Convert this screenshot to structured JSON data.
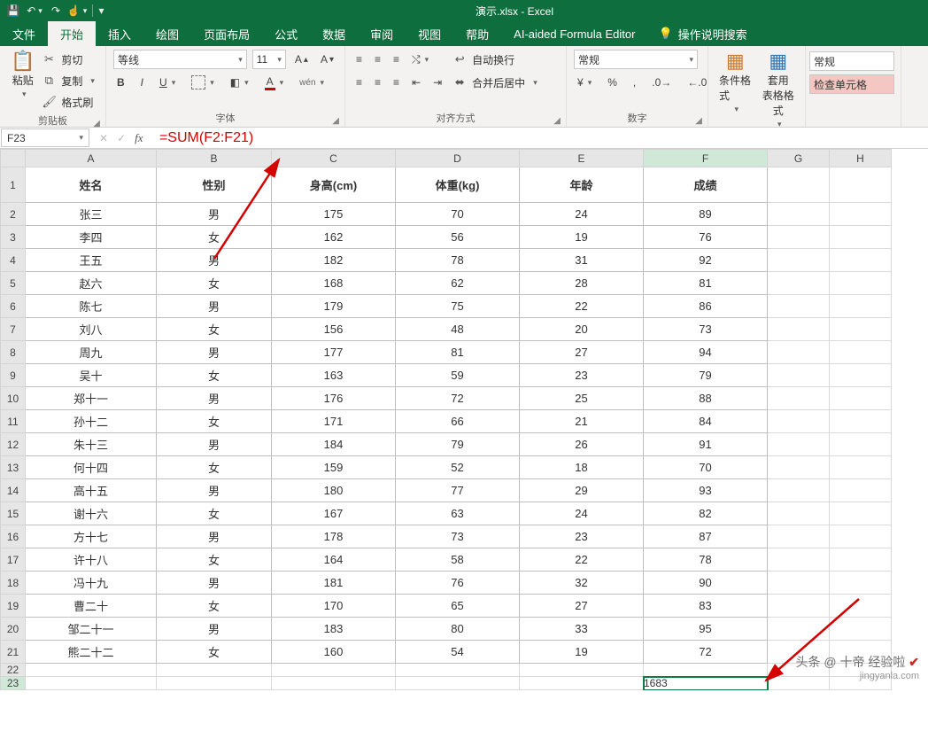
{
  "app": {
    "title": "演示.xlsx  -  Excel"
  },
  "qat": {
    "save": "save-icon",
    "undo": "undo-icon",
    "redo": "redo-icon",
    "touch": "touch-icon"
  },
  "menu": {
    "file": "文件",
    "home": "开始",
    "insert": "插入",
    "draw": "绘图",
    "layout": "页面布局",
    "formulas": "公式",
    "data": "数据",
    "review": "审阅",
    "view": "视图",
    "help": "帮助",
    "ai": "AI-aided Formula Editor",
    "tell_me": "操作说明搜索"
  },
  "ribbon": {
    "clipboard": {
      "paste": "粘贴",
      "cut": "剪切",
      "copy": "复制",
      "format_painter": "格式刷",
      "label": "剪贴板"
    },
    "font": {
      "name": "等线",
      "size": "11",
      "label": "字体",
      "wen": "wén"
    },
    "align": {
      "wrap": "自动换行",
      "merge": "合并后居中",
      "label": "对齐方式"
    },
    "number": {
      "format": "常规",
      "label": "数字"
    },
    "styles": {
      "cond": "条件格式",
      "table": "套用\n表格格式",
      "label": ""
    },
    "cells2": {
      "normal": "常规",
      "check": "检查单元格"
    }
  },
  "formula_bar": {
    "name_box": "F23",
    "formula": " =SUM(F2:F21)"
  },
  "columns": [
    "A",
    "B",
    "C",
    "D",
    "E",
    "F",
    "G",
    "H"
  ],
  "headers": {
    "c1": "姓名",
    "c2": "性别",
    "c3": "身高(cm)",
    "c4": "体重(kg)",
    "c5": "年龄",
    "c6": "成绩"
  },
  "rows": [
    {
      "n": "张三",
      "g": "男",
      "h": "175",
      "w": "70",
      "a": "24",
      "s": "89"
    },
    {
      "n": "李四",
      "g": "女",
      "h": "162",
      "w": "56",
      "a": "19",
      "s": "76"
    },
    {
      "n": "王五",
      "g": "男",
      "h": "182",
      "w": "78",
      "a": "31",
      "s": "92"
    },
    {
      "n": "赵六",
      "g": "女",
      "h": "168",
      "w": "62",
      "a": "28",
      "s": "81"
    },
    {
      "n": "陈七",
      "g": "男",
      "h": "179",
      "w": "75",
      "a": "22",
      "s": "86"
    },
    {
      "n": "刘八",
      "g": "女",
      "h": "156",
      "w": "48",
      "a": "20",
      "s": "73"
    },
    {
      "n": "周九",
      "g": "男",
      "h": "177",
      "w": "81",
      "a": "27",
      "s": "94"
    },
    {
      "n": "吴十",
      "g": "女",
      "h": "163",
      "w": "59",
      "a": "23",
      "s": "79"
    },
    {
      "n": "郑十一",
      "g": "男",
      "h": "176",
      "w": "72",
      "a": "25",
      "s": "88"
    },
    {
      "n": "孙十二",
      "g": "女",
      "h": "171",
      "w": "66",
      "a": "21",
      "s": "84"
    },
    {
      "n": "朱十三",
      "g": "男",
      "h": "184",
      "w": "79",
      "a": "26",
      "s": "91"
    },
    {
      "n": "何十四",
      "g": "女",
      "h": "159",
      "w": "52",
      "a": "18",
      "s": "70"
    },
    {
      "n": "高十五",
      "g": "男",
      "h": "180",
      "w": "77",
      "a": "29",
      "s": "93"
    },
    {
      "n": "谢十六",
      "g": "女",
      "h": "167",
      "w": "63",
      "a": "24",
      "s": "82"
    },
    {
      "n": "方十七",
      "g": "男",
      "h": "178",
      "w": "73",
      "a": "23",
      "s": "87"
    },
    {
      "n": "许十八",
      "g": "女",
      "h": "164",
      "w": "58",
      "a": "22",
      "s": "78"
    },
    {
      "n": "冯十九",
      "g": "男",
      "h": "181",
      "w": "76",
      "a": "32",
      "s": "90"
    },
    {
      "n": "曹二十",
      "g": "女",
      "h": "170",
      "w": "65",
      "a": "27",
      "s": "83"
    },
    {
      "n": "邹二十一",
      "g": "男",
      "h": "183",
      "w": "80",
      "a": "33",
      "s": "95"
    },
    {
      "n": "熊二十二",
      "g": "女",
      "h": "160",
      "w": "54",
      "a": "19",
      "s": "72"
    }
  ],
  "sum_cell": "1683",
  "watermark": {
    "line1": "头条 @ 十帝 经验啦",
    "line2": "jingyanla.com"
  }
}
